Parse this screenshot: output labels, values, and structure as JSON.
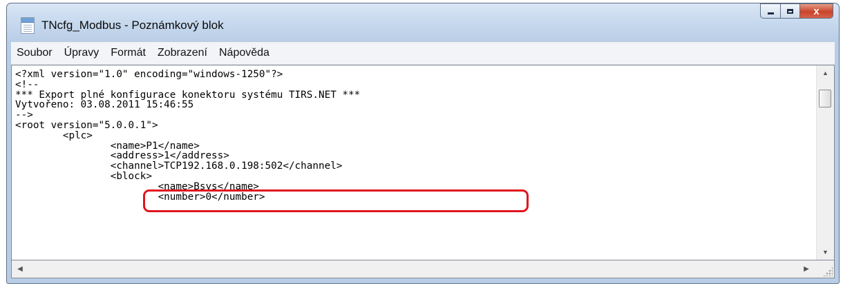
{
  "window": {
    "title": "TNcfg_Modbus - Poznámkový blok",
    "controls": {
      "minimize_icon": "minimize-icon",
      "maximize_icon": "maximize-icon",
      "close_icon": "close-icon",
      "close_glyph": "x"
    }
  },
  "menu": [
    {
      "label": "Soubor"
    },
    {
      "label": "Úpravy"
    },
    {
      "label": "Formát"
    },
    {
      "label": "Zobrazení"
    },
    {
      "label": "Nápověda"
    }
  ],
  "document": {
    "lines": [
      "<?xml version=\"1.0\" encoding=\"windows-1250\"?>",
      "<!--",
      "*** Export plné konfigurace konektoru systému TIRS.NET ***",
      "Vytvořeno: 03.08.2011 15:46:55",
      "-->",
      "<root version=\"5.0.0.1\">",
      "        <plc>",
      "                <name>P1</name>",
      "                <address>1</address>",
      "                <channel>TCP192.168.0.198:502</channel>",
      "                <block>",
      "                        <name>Bsys</name>",
      "                        <number>0</number>"
    ]
  },
  "annotation": {
    "color": "#e0141e",
    "highlighted_line": 9
  },
  "scrollbars": {
    "up_glyph": "▲",
    "down_glyph": "▼",
    "left_glyph": "◀",
    "right_glyph": "▶"
  }
}
